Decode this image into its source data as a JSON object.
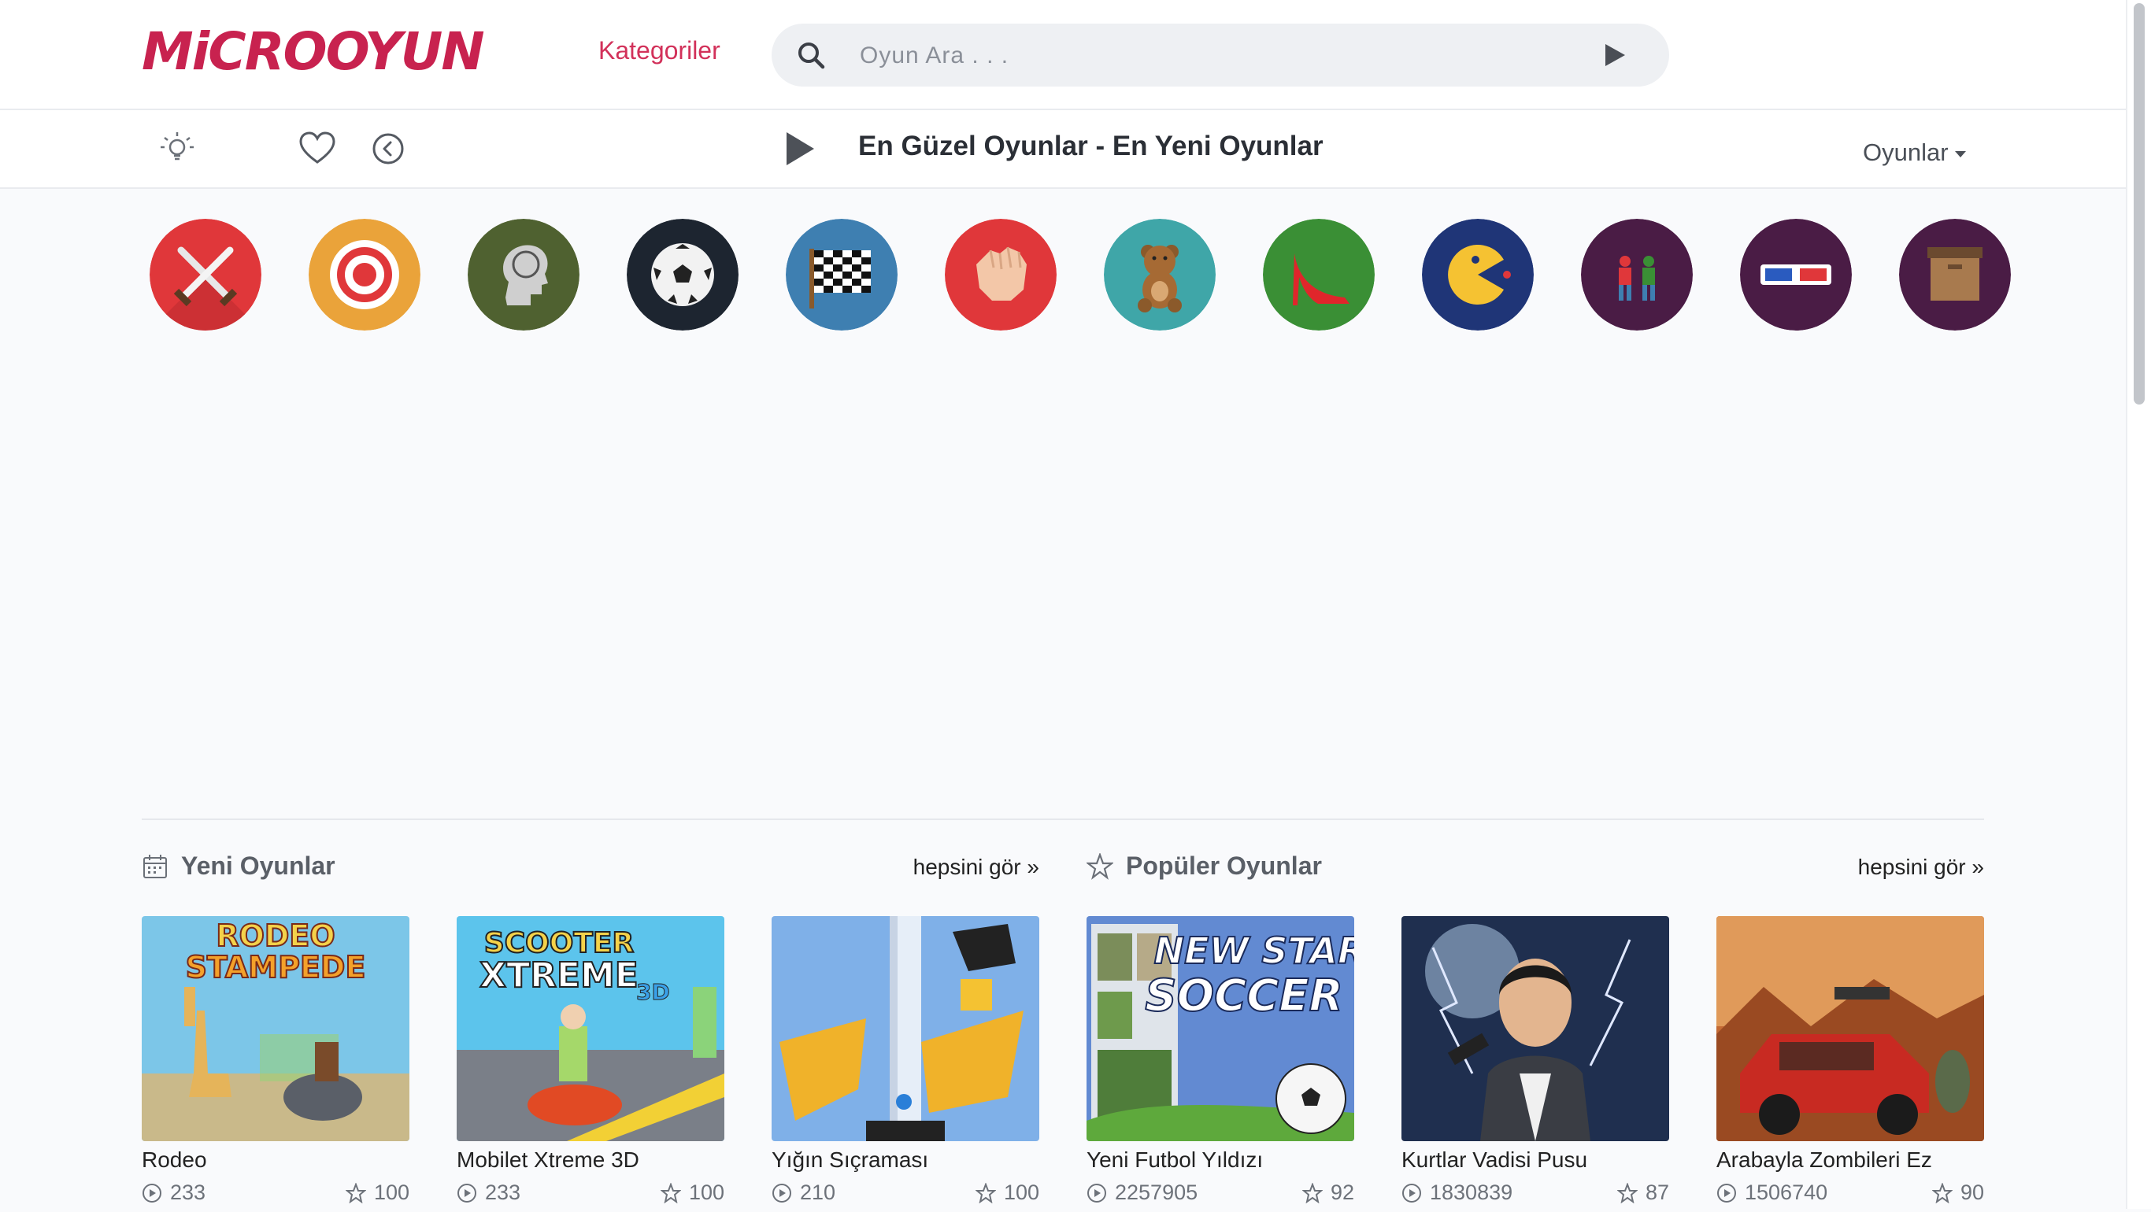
{
  "header": {
    "logo_text": "MiCROOYUN",
    "nav_categories": "Kategoriler",
    "search": {
      "placeholder": "Oyun Ara . . ."
    }
  },
  "toolbar": {
    "heading": "En Güzel Oyunlar - En Yeni Oyunlar",
    "games_menu": "Oyunlar"
  },
  "categories": [
    {
      "icon": "crossed-swords-icon",
      "color": "#e0373a"
    },
    {
      "icon": "target-icon",
      "color": "#eaa33a"
    },
    {
      "icon": "brain-head-icon",
      "color": "#4f6130"
    },
    {
      "icon": "soccer-ball-icon",
      "color": "#1d2530"
    },
    {
      "icon": "checkered-flag-icon",
      "color": "#3e7fb1"
    },
    {
      "icon": "fist-icon",
      "color": "#e0373a"
    },
    {
      "icon": "teddy-bear-icon",
      "color": "#3fa6a8"
    },
    {
      "icon": "high-heel-icon",
      "color": "#3a8f35"
    },
    {
      "icon": "pacman-icon",
      "color": "#1f3577"
    },
    {
      "icon": "two-players-icon",
      "color": "#4a1c45"
    },
    {
      "icon": "3d-glasses-icon",
      "color": "#4a1c45"
    },
    {
      "icon": "box-icon",
      "color": "#4a1c45"
    }
  ],
  "sections": {
    "new": {
      "title": "Yeni Oyunlar",
      "see_all": "hepsini gör »",
      "games": [
        {
          "title": "Rodeo",
          "plays": "233",
          "rating": "100",
          "thumb_text": "RODEO STAMPEDE"
        },
        {
          "title": "Mobilet Xtreme 3D",
          "plays": "233",
          "rating": "100",
          "thumb_text": "SCOOTER XTREME 3D"
        },
        {
          "title": "Yığın Sıçraması",
          "plays": "210",
          "rating": "100",
          "thumb_text": ""
        }
      ]
    },
    "popular": {
      "title": "Popüler Oyunlar",
      "see_all": "hepsini gör »",
      "games": [
        {
          "title": "Yeni Futbol Yıldızı",
          "plays": "2257905",
          "rating": "92",
          "thumb_text": "NEW STAR SOCCER"
        },
        {
          "title": "Kurtlar Vadisi Pusu",
          "plays": "1830839",
          "rating": "87",
          "thumb_text": ""
        },
        {
          "title": "Arabayla Zombileri Ez",
          "plays": "1506740",
          "rating": "90",
          "thumb_text": ""
        }
      ]
    }
  },
  "colors": {
    "brand": "#c8224f",
    "accent": "#d2315a",
    "page_bg": "#f9fafc"
  }
}
